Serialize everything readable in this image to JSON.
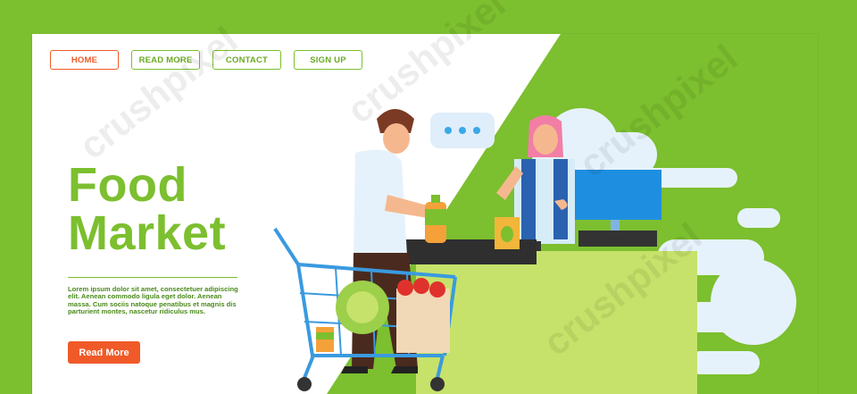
{
  "nav": {
    "items": [
      {
        "label": "HOME",
        "active": true
      },
      {
        "label": "READ MORE",
        "active": false
      },
      {
        "label": "CONTACT",
        "active": false
      },
      {
        "label": "SIGN UP",
        "active": false
      }
    ]
  },
  "hero": {
    "title_line1": "Food",
    "title_line2": "Market",
    "body": "Lorem ipsum dolor sit amet, consectetuer adipiscing elit. Aenean commodo ligula eget dolor. Aenean massa. Cum sociis natoque penatibus et magnis dis parturient montes, nascetur ridiculus mus.",
    "cta_label": "Read More"
  },
  "watermark": "crushpixel",
  "colors": {
    "brand_green": "#7cbf2f",
    "accent_orange": "#f05a28",
    "light_green": "#c6e26a",
    "sky_blue": "#3aa9e8"
  }
}
